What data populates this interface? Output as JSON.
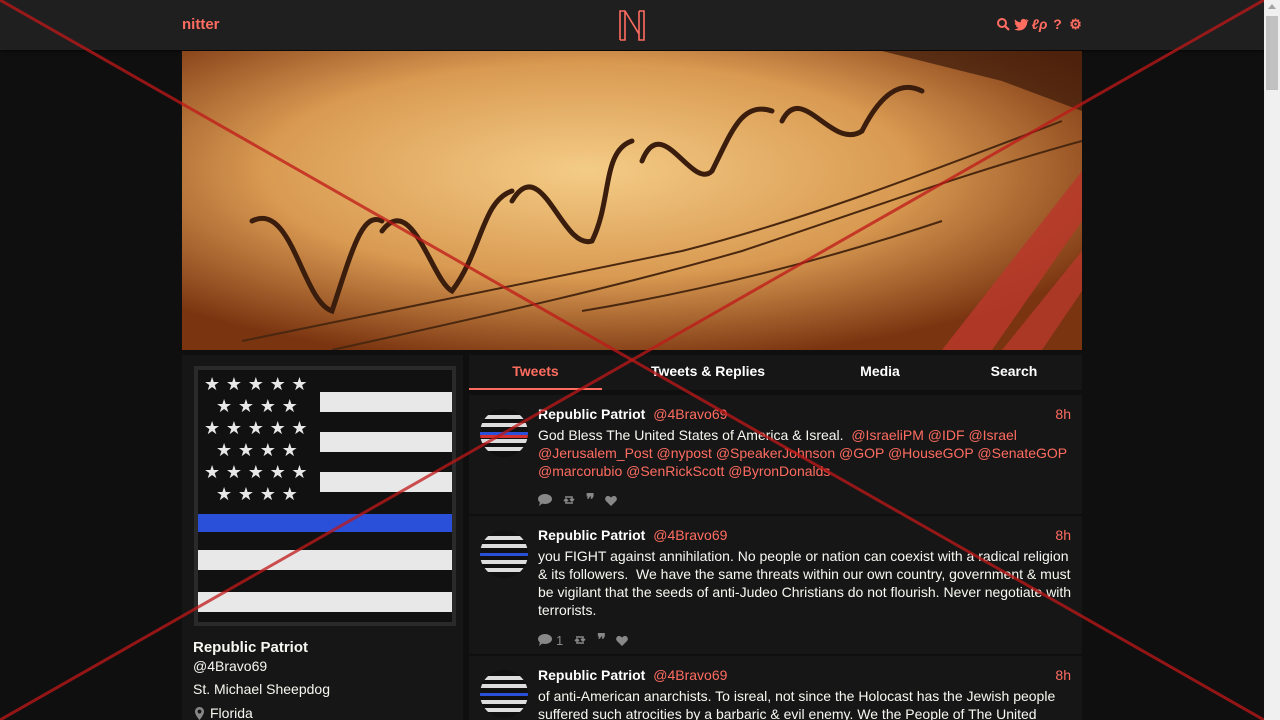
{
  "nav": {
    "brand": "nitter",
    "logo_letter": "N",
    "icons": [
      "search-icon",
      "twitter-bird-icon",
      "lp-icon",
      "help-icon",
      "gear-icon"
    ]
  },
  "colors": {
    "accent": "#ff6c60",
    "background": "#0f0f0f",
    "panel": "#161616",
    "navbar": "#1f1f1f"
  },
  "profile": {
    "fullname": "Republic Patriot",
    "username": "@4Bravo69",
    "bio": "St. Michael Sheepdog",
    "location": "Florida"
  },
  "tabs": [
    {
      "label": "Tweets",
      "active": true
    },
    {
      "label": "Tweets & Replies",
      "active": false
    },
    {
      "label": "Media",
      "active": false
    },
    {
      "label": "Search",
      "active": false
    }
  ],
  "tweets": [
    {
      "name": "Republic Patriot",
      "handle": "@4Bravo69",
      "date": "8h",
      "text_plain": "God Bless The United States of America & Isreal.  ",
      "mentions_line": "@IsraeliPM @IDF @Israel @Jerusalem_Post @nypost @SpeakerJohnson @GOP @HouseGOP @SenateGOP @marcorubio @SenRickScott @ByronDonalds",
      "replies": "",
      "retweets": "",
      "quotes": "",
      "likes": ""
    },
    {
      "name": "Republic Patriot",
      "handle": "@4Bravo69",
      "date": "8h",
      "text_plain": "you FIGHT against annihilation. No people or nation can coexist with a radical religion & its followers.  We have the same threats within our own country, government & must be vigilant that the seeds of anti-Judeo Christians do not flourish. Never negotiate with terrorists.",
      "replies": "1",
      "retweets": "",
      "quotes": "",
      "likes": ""
    },
    {
      "name": "Republic Patriot",
      "handle": "@4Bravo69",
      "date": "8h",
      "text_plain": "of anti-American anarchists. To isreal, not since the Holocast has the Jewish people suffered such atrocities by a barbaric & evil enemy. We the People of The United"
    }
  ]
}
